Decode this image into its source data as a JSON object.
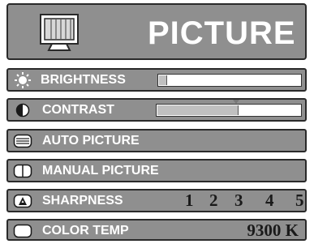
{
  "header": {
    "title": "PICTURE",
    "icon": "monitor-icon"
  },
  "menu": {
    "brightness": {
      "label": "BRIGHTNESS",
      "icon": "sun-icon",
      "level_fraction": 0.05
    },
    "contrast": {
      "label": "CONTRAST",
      "icon": "contrast-icon",
      "level_fraction": 0.56,
      "default_fraction": 0.55
    },
    "auto_picture": {
      "label": "AUTO PICTURE",
      "icon": "auto-picture-icon"
    },
    "manual_picture": {
      "label": "MANUAL PICTURE",
      "icon": "manual-picture-icon"
    },
    "sharpness": {
      "label": "SHARPNESS",
      "icon": "sharpness-icon",
      "levels": [
        "1",
        "2",
        "3",
        "4",
        "5"
      ]
    },
    "color_temp": {
      "label": "COLOR TEMP",
      "icon": "color-temp-icon",
      "value": "9300 K"
    }
  },
  "colors": {
    "panel": "#8f8f8f",
    "border": "#2a2a2a",
    "text": "#ffffff",
    "value_text": "#1a1a1a"
  }
}
